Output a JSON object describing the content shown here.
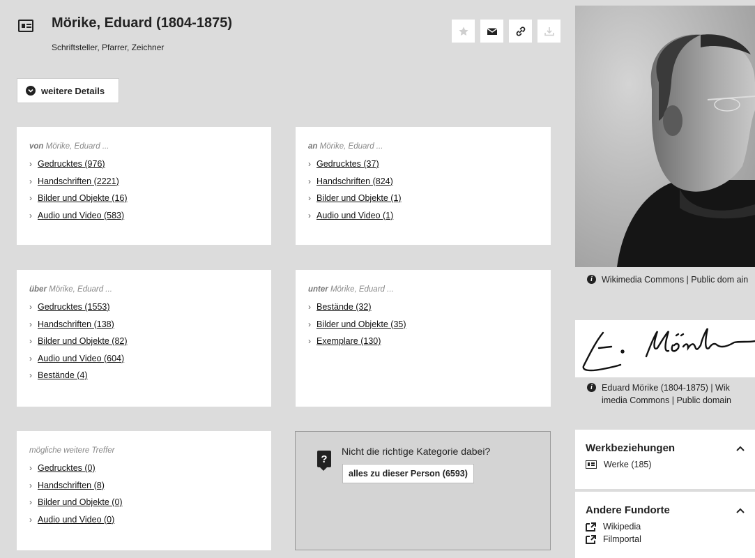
{
  "header": {
    "title": "Mörike, Eduard (1804-1875)",
    "subtitle": "Schriftsteller, Pfarrer, Zeichner"
  },
  "details_button": {
    "label": "weitere Details"
  },
  "cards": {
    "von": {
      "prefix": "von",
      "suffix": "Mörike, Eduard ...",
      "links": [
        "Gedrucktes (976)",
        "Handschriften (2221)",
        "Bilder und Objekte (16)",
        "Audio und Video (583)"
      ]
    },
    "an": {
      "prefix": "an",
      "suffix": "Mörike, Eduard ...",
      "links": [
        "Gedrucktes (37)",
        "Handschriften (824)",
        "Bilder und Objekte (1)",
        "Audio und Video (1)"
      ]
    },
    "ueber": {
      "prefix": "über",
      "suffix": "Mörike, Eduard ...",
      "links": [
        "Gedrucktes (1553)",
        "Handschriften (138)",
        "Bilder und Objekte (82)",
        "Audio und Video (604)",
        "Bestände (4)"
      ]
    },
    "unter": {
      "prefix": "unter",
      "suffix": "Mörike, Eduard ...",
      "links": [
        "Bestände (32)",
        "Bilder und Objekte (35)",
        "Exemplare (130)"
      ]
    },
    "weitere": {
      "heading": "mögliche weitere Treffer",
      "links": [
        "Gedrucktes (0)",
        "Handschriften (8)",
        "Bilder und Objekte (0)",
        "Audio und Video (0)"
      ]
    }
  },
  "hint": {
    "text": "Nicht die richtige Kategorie dabei?",
    "button": "alles zu dieser Person (6593)"
  },
  "sidebar": {
    "portrait_caption": "Wikimedia Commons | Public dom ain",
    "signature_caption": "Eduard Mörike (1804-1875) | Wik imedia Commons | Public domain",
    "werkbeziehungen": {
      "title": "Werkbeziehungen",
      "items": [
        "Werke (185)"
      ]
    },
    "fundorte": {
      "title": "Andere Fundorte",
      "items": [
        "Wikipedia",
        "Filmportal"
      ]
    }
  }
}
